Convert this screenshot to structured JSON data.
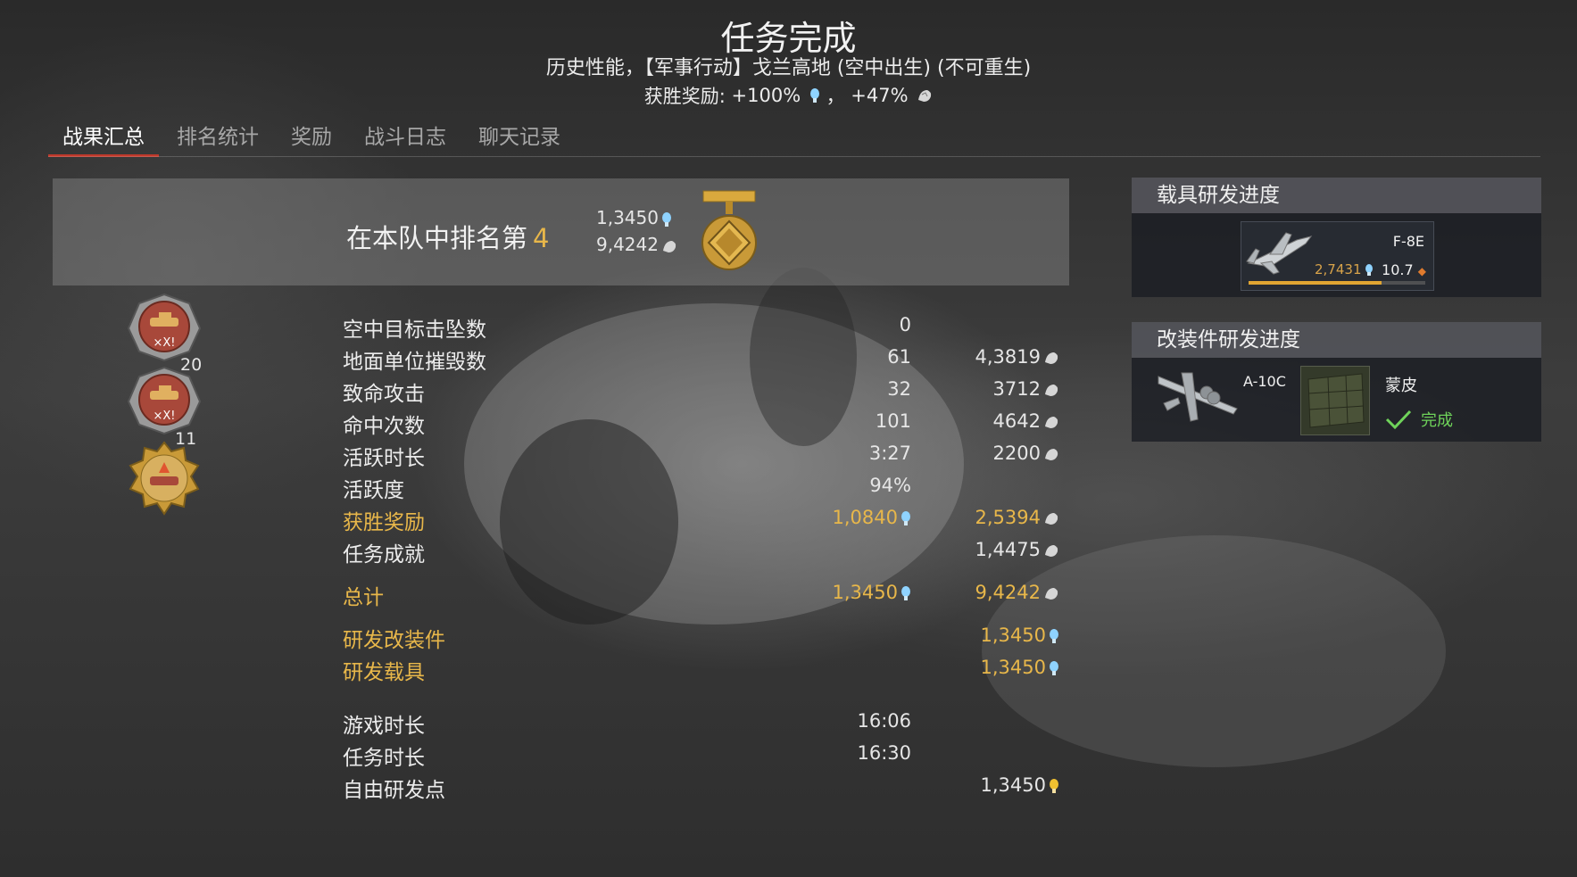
{
  "header": {
    "title": "任务完成",
    "subtitle": "历史性能，【军事行动】戈兰高地 (空中出生) (不可重生)",
    "reward_label": "获胜奖励:",
    "reward_rp": "+100%",
    "reward_sep": "，",
    "reward_sl": "+47%"
  },
  "tabs": [
    {
      "label": "战果汇总",
      "active": true
    },
    {
      "label": "排名统计",
      "active": false
    },
    {
      "label": "奖励",
      "active": false
    },
    {
      "label": "战斗日志",
      "active": false
    },
    {
      "label": "聊天记录",
      "active": false
    }
  ],
  "rank": {
    "text": "在本队中排名第",
    "position": "4",
    "rp": "1,3450",
    "sl": "9,4242"
  },
  "medals": {
    "medal1_count": "20",
    "medal2_count": "11"
  },
  "stats": [
    {
      "label": "空中目标击坠数",
      "col1": "0",
      "col2": ""
    },
    {
      "label": "地面单位摧毁数",
      "col1": "61",
      "col2": "4,3819"
    },
    {
      "label": "致命攻击",
      "col1": "32",
      "col2": "3712"
    },
    {
      "label": "命中次数",
      "col1": "101",
      "col2": "4642"
    },
    {
      "label": "活跃时长",
      "col1": "3:27",
      "col2": "2200"
    },
    {
      "label": "活跃度",
      "col1": "94%",
      "col2": ""
    },
    {
      "label": "获胜奖励",
      "col1": "1,0840",
      "col2": "2,5394"
    },
    {
      "label": "任务成就",
      "col1": "",
      "col2": "1,4475"
    },
    {
      "label": "总计",
      "col1": "1,3450",
      "col2": "9,4242"
    },
    {
      "label": "研发改装件",
      "col1": "",
      "col2": "1,3450"
    },
    {
      "label": "研发载具",
      "col1": "",
      "col2": "1,3450"
    },
    {
      "label": "游戏时长",
      "col1": "16:06",
      "col2": ""
    },
    {
      "label": "任务时长",
      "col1": "16:30",
      "col2": ""
    },
    {
      "label": "自由研发点",
      "col1": "",
      "col2": "1,3450"
    }
  ],
  "vehicle_research": {
    "title": "载具研发进度",
    "vehicle": "F-8E",
    "rp": "2,7431",
    "br": "10.7",
    "progress": 0.75
  },
  "mod_research": {
    "title": "改装件研发进度",
    "vehicle": "A-10C",
    "mod": "蒙皮",
    "status": "完成"
  },
  "colors": {
    "gold": "#e8b74a",
    "accent_tab": "#c0392b",
    "complete_green": "#6fd35a",
    "rp_blue": "#8fd3ff",
    "br_orange": "#e07b2e"
  }
}
